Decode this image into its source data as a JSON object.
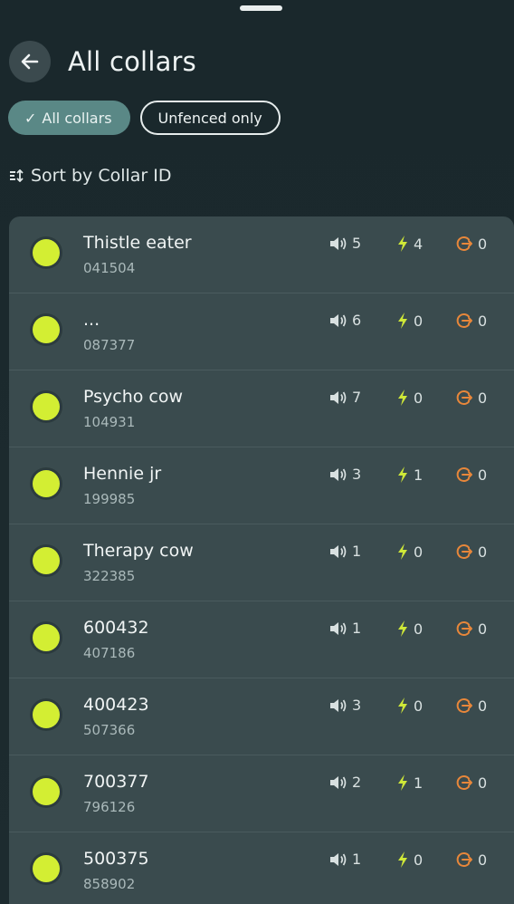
{
  "header": {
    "title": "All collars"
  },
  "filters": {
    "all_label": "All collars",
    "unfenced_label": "Unfenced only"
  },
  "sort": {
    "label": "Sort by Collar ID"
  },
  "colors": {
    "dot": "#d3ee33",
    "shock": "#cfe838",
    "fence": "#e8873a",
    "chip_active": "#5a8886"
  },
  "collars": [
    {
      "name": "Thistle eater",
      "id": "041504",
      "sound": "5",
      "shock": "4",
      "fence": "0"
    },
    {
      "name": "...",
      "id": "087377",
      "sound": "6",
      "shock": "0",
      "fence": "0"
    },
    {
      "name": "Psycho cow",
      "id": "104931",
      "sound": "7",
      "shock": "0",
      "fence": "0"
    },
    {
      "name": "Hennie jr",
      "id": "199985",
      "sound": "3",
      "shock": "1",
      "fence": "0"
    },
    {
      "name": "Therapy cow",
      "id": "322385",
      "sound": "1",
      "shock": "0",
      "fence": "0"
    },
    {
      "name": "600432",
      "id": "407186",
      "sound": "1",
      "shock": "0",
      "fence": "0"
    },
    {
      "name": "400423",
      "id": "507366",
      "sound": "3",
      "shock": "0",
      "fence": "0"
    },
    {
      "name": "700377",
      "id": "796126",
      "sound": "2",
      "shock": "1",
      "fence": "0"
    },
    {
      "name": "500375",
      "id": "858902",
      "sound": "1",
      "shock": "0",
      "fence": "0"
    }
  ]
}
